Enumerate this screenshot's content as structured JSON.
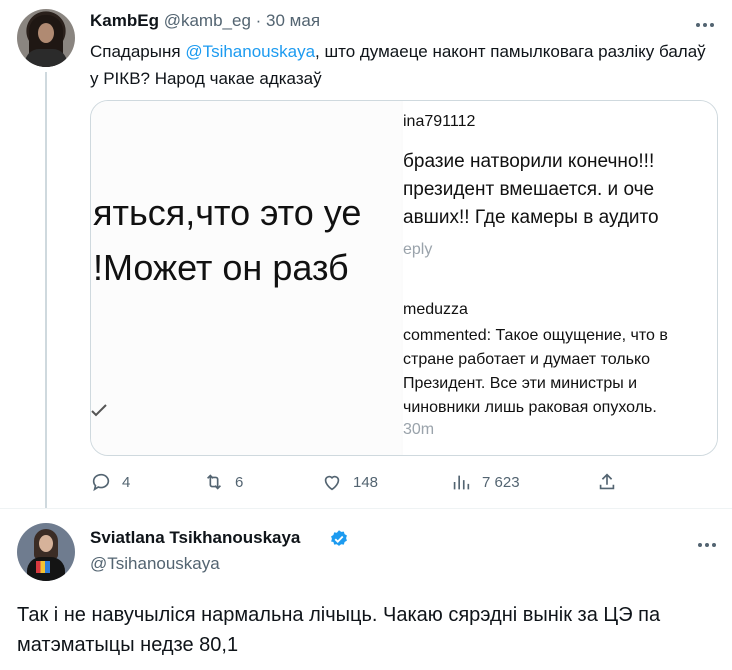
{
  "tweet1": {
    "author_name": "KambEg",
    "author_handle": "@kamb_eg",
    "separator": "·",
    "date": "30 мая",
    "text_before": "Спадарыня ",
    "mention": "@Tsihanouskaya",
    "text_after": ", што думаеце наконт памылковага разліку балаў у РІКВ? Народ чакае адказаў",
    "image": {
      "left_line1": "яться,что это уе",
      "left_line2": "!Может он разб",
      "right_user1": "ina791112",
      "right_line1": "бразие натворили конечно!!!",
      "right_line2": "президент вмешается. и оче",
      "right_line3": "авших!! Где камеры в аудито",
      "right_reply": "eply",
      "right_user2": "meduzza",
      "right_m1": "commented: Такое ощущение, что в",
      "right_m2": "стране работает и думает только",
      "right_m3": "Президент. Все эти министры и",
      "right_m4": "чиновники лишь раковая опухоль.",
      "right_time": "30m"
    },
    "stats": {
      "replies": "4",
      "retweets": "6",
      "likes": "148",
      "views": "7 623"
    }
  },
  "tweet2": {
    "author_name": "Sviatlana Tsikhanouskaya",
    "author_handle": "@Tsihanouskaya",
    "verified_color": "#1d9bf0",
    "text": "Так і не навучыліся нармальна лічыць. Чакаю сярэдні вынік за ЦЭ па матэматыцы недзе 80,1"
  },
  "colors": {
    "accent": "#1d9bf0",
    "muted": "#536471",
    "text": "#0f1419"
  },
  "icons": [
    "more-icon",
    "reply-icon",
    "retweet-icon",
    "like-icon",
    "views-icon",
    "share-icon",
    "verified-badge-icon",
    "checkmark-icon"
  ]
}
